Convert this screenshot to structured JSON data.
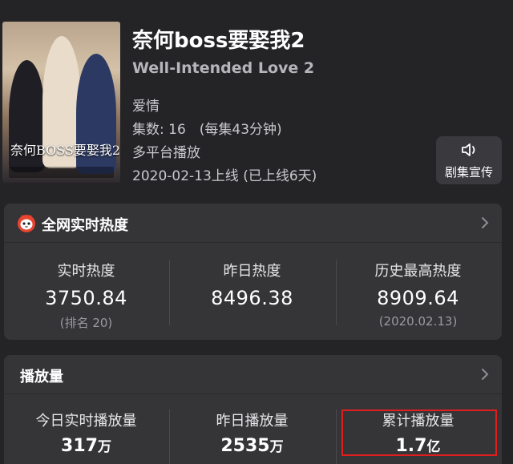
{
  "show": {
    "title": "奈何boss要娶我2",
    "subtitle": "Well-Intended Love 2",
    "genre": "爱情",
    "episodes": "集数: 16　(每集43分钟)",
    "platform": "多平台播放",
    "release": "2020-02-13上线 (已上线6天)",
    "poster_title": "奈何BOSS要娶我2"
  },
  "promo_button": {
    "label": "剧集宣传",
    "icon": "speaker-icon"
  },
  "heat_card": {
    "title": "全网实时热度",
    "icon": "cat-logo-icon",
    "stats": [
      {
        "label": "实时热度",
        "value": "3750.84",
        "sub": "(排名 20)"
      },
      {
        "label": "昨日热度",
        "value": "8496.38",
        "sub": ""
      },
      {
        "label": "历史最高热度",
        "value": "8909.64",
        "sub": "(2020.02.13)"
      }
    ]
  },
  "play_card": {
    "title": "播放量",
    "stats": [
      {
        "label": "今日实时播放量",
        "value": "317",
        "unit": "万"
      },
      {
        "label": "昨日播放量",
        "value": "2535",
        "unit": "万"
      },
      {
        "label": "累计播放量",
        "value": "1.7",
        "unit": "亿"
      }
    ]
  },
  "colors": {
    "background": "#242427",
    "card": "#353538",
    "highlight": "#e11d1d",
    "logo": "#e8442f"
  }
}
